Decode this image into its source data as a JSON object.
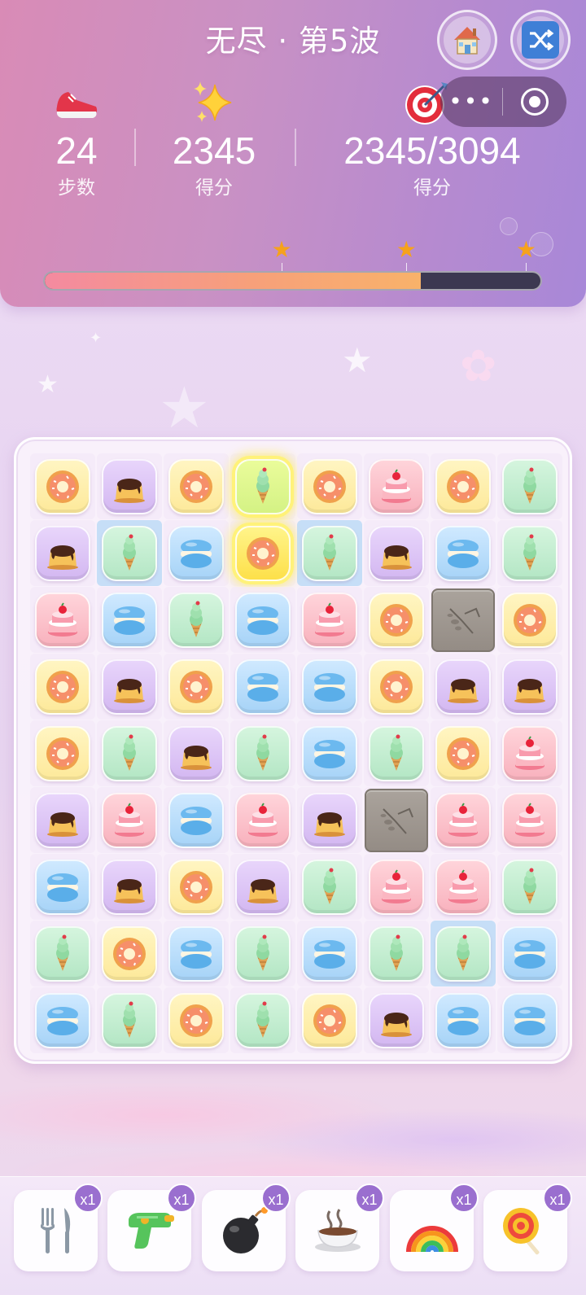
{
  "header": {
    "title": "无尽 · 第5波",
    "home_icon": "house-icon",
    "shuffle_icon": "shuffle-icon",
    "capsule_more": "•••",
    "stats": [
      {
        "icon": "sneaker-icon",
        "value": "24",
        "label": "步数"
      },
      {
        "icon": "sparkles-icon",
        "value": "2345",
        "label": "得分"
      },
      {
        "icon": "target-icon",
        "value": "2345/3094",
        "label": "得分"
      }
    ],
    "progress": {
      "value": 0.758,
      "star_thresholds": [
        0.478,
        0.728,
        0.968
      ]
    },
    "colors": {
      "fill_start": "#f48aa0",
      "fill_end": "#f8b26a",
      "track": "#3c3851",
      "star": "#f6a21c"
    }
  },
  "board": {
    "rows": [
      [
        "donut",
        "pudding",
        "donut",
        "icecream-selected",
        "donut",
        "cake",
        "donut",
        "icecream"
      ],
      [
        "pudding",
        "icecream-blue",
        "macaron",
        "donut-selected",
        "icecream-blue",
        "pudding",
        "macaron",
        "icecream"
      ],
      [
        "cake",
        "macaron",
        "icecream",
        "macaron",
        "cake",
        "donut",
        "rock",
        "donut"
      ],
      [
        "donut",
        "pudding",
        "donut",
        "macaron",
        "macaron",
        "donut",
        "pudding",
        "pudding"
      ],
      [
        "donut",
        "icecream",
        "pudding",
        "icecream",
        "macaron",
        "icecream",
        "donut",
        "cake"
      ],
      [
        "pudding",
        "cake",
        "macaron",
        "cake",
        "pudding",
        "rock",
        "cake",
        "cake"
      ],
      [
        "macaron",
        "pudding",
        "donut",
        "pudding",
        "icecream",
        "cake",
        "cake",
        "icecream"
      ],
      [
        "icecream",
        "donut",
        "macaron",
        "icecream",
        "macaron",
        "icecream",
        "icecream-blue",
        "macaron"
      ],
      [
        "macaron",
        "icecream",
        "donut",
        "icecream",
        "donut",
        "pudding",
        "macaron",
        "macaron"
      ]
    ]
  },
  "toolbar": {
    "tools": [
      {
        "name": "fork-knife-icon",
        "count": "x1"
      },
      {
        "name": "water-gun-icon",
        "count": "x1"
      },
      {
        "name": "bomb-icon",
        "count": "x1"
      },
      {
        "name": "hot-drink-icon",
        "count": "x1"
      },
      {
        "name": "rainbow-icon",
        "count": "x1"
      },
      {
        "name": "lollipop-icon",
        "count": "x1"
      }
    ]
  }
}
